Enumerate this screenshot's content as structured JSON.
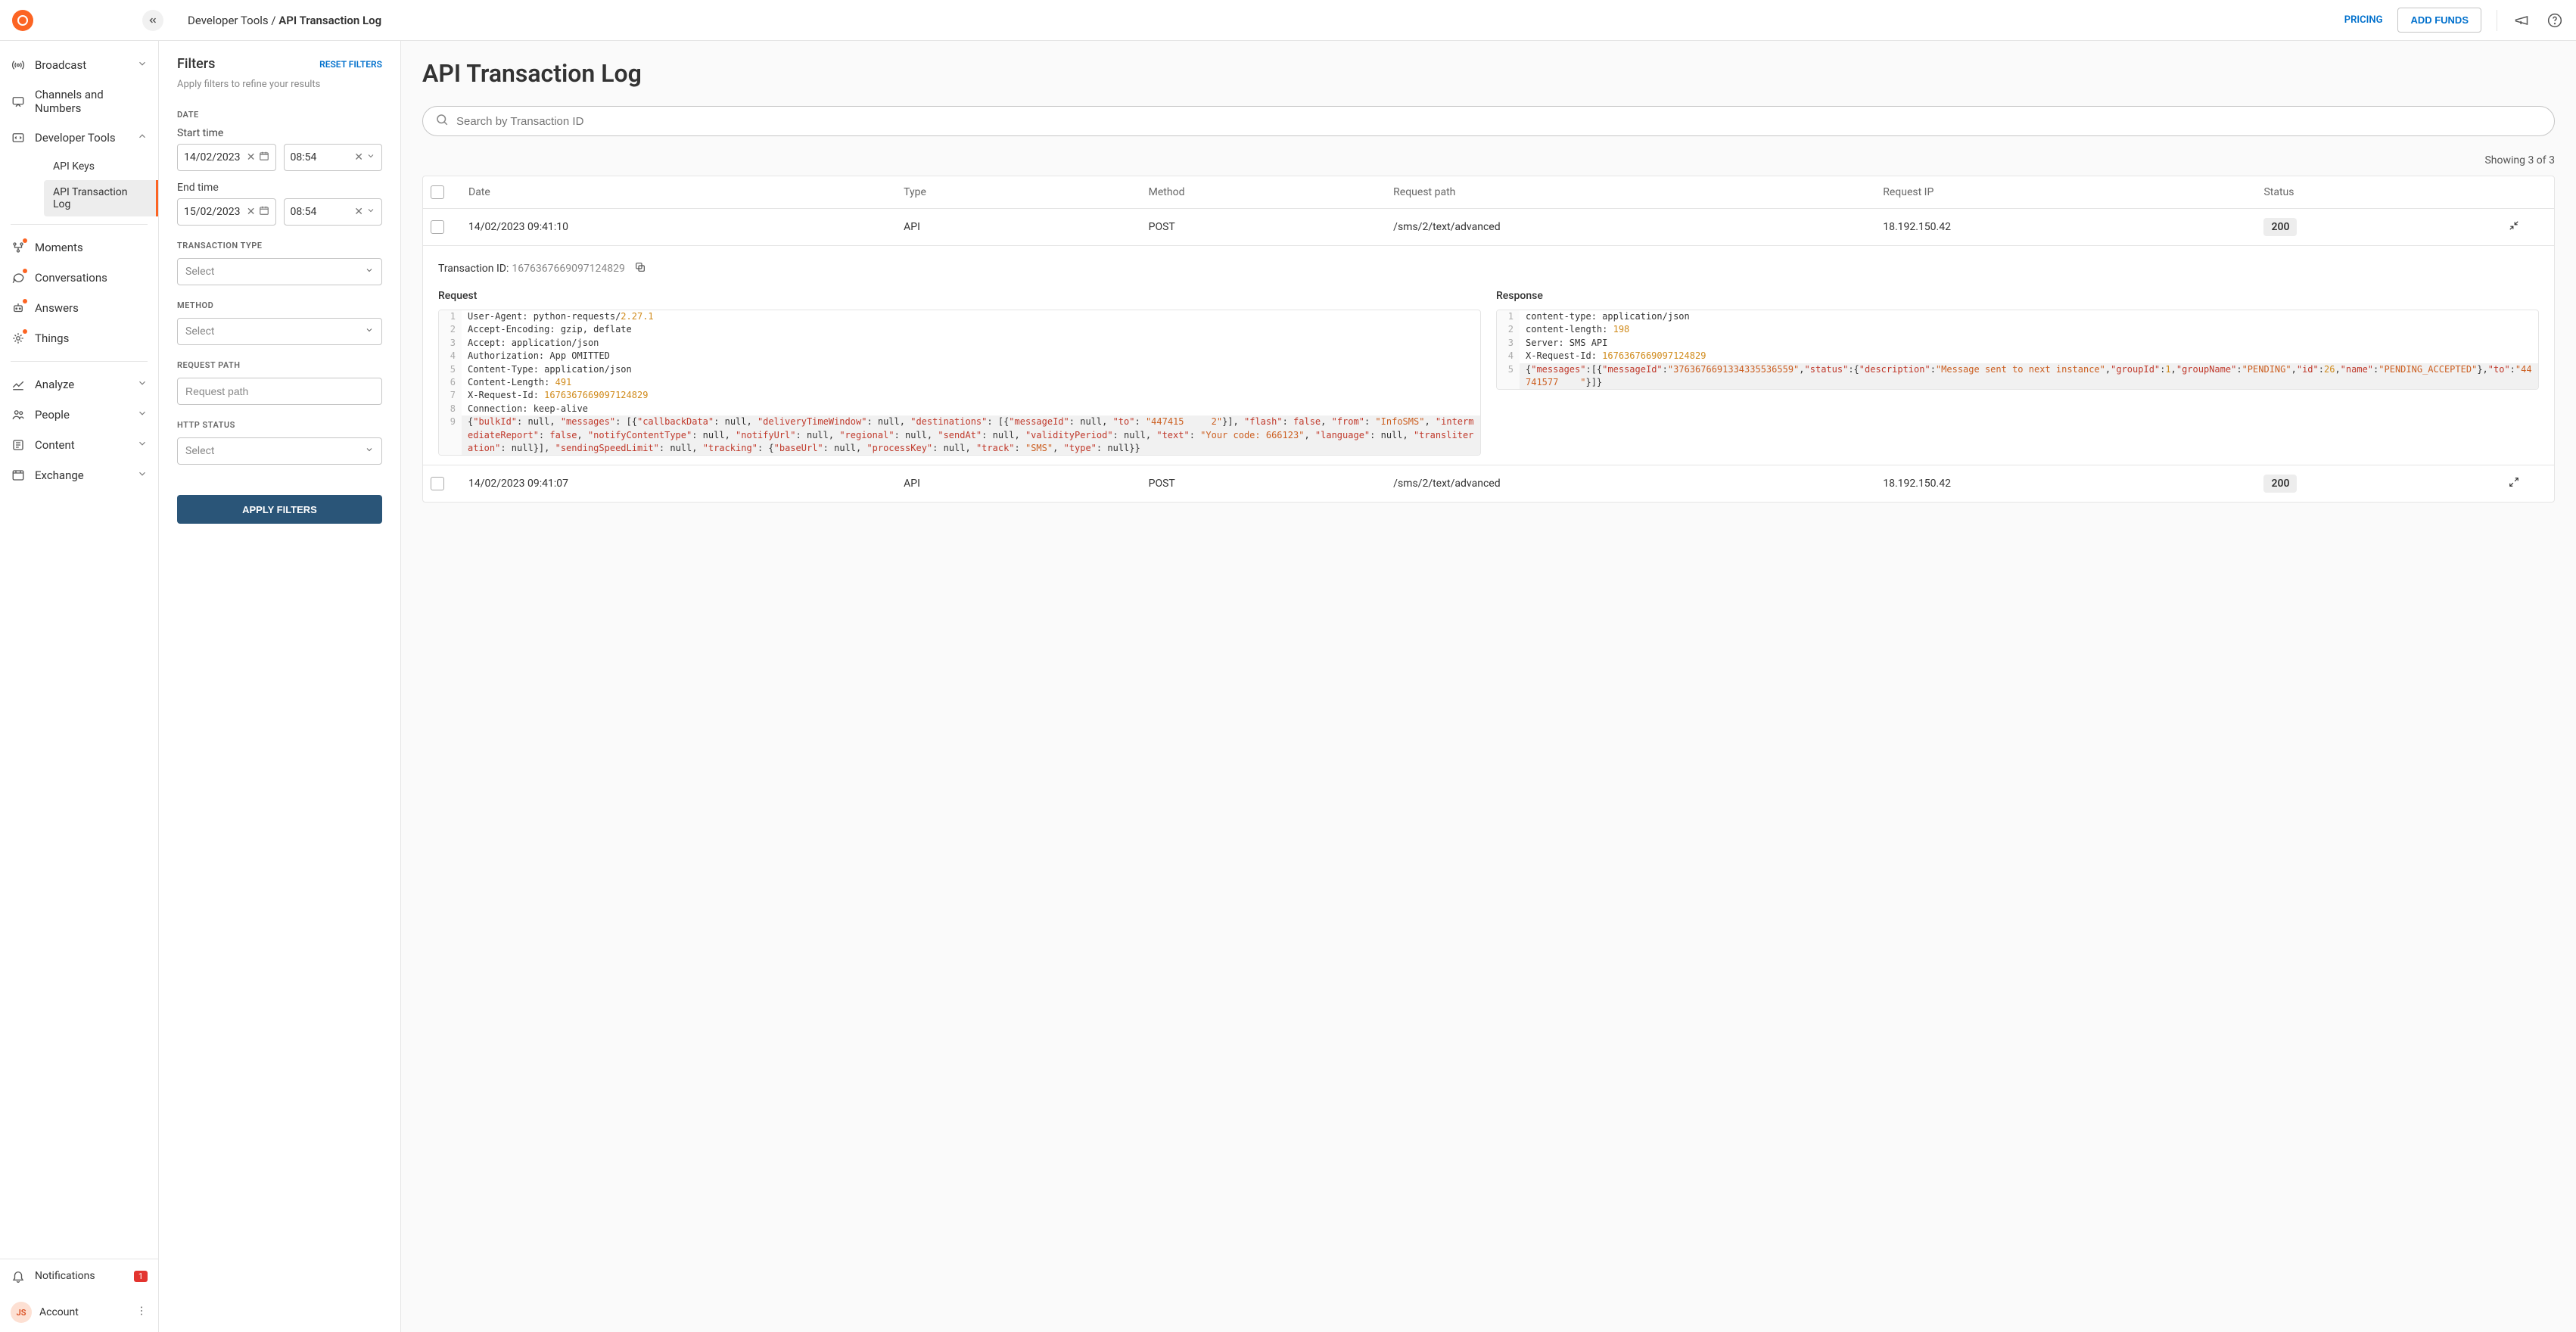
{
  "header": {
    "breadcrumb_parent": "Developer Tools",
    "breadcrumb_sep": " / ",
    "breadcrumb_current": "API Transaction Log",
    "pricing": "PRICING",
    "add_funds": "ADD FUNDS"
  },
  "sidebar": {
    "broadcast": "Broadcast",
    "channels": "Channels and Numbers",
    "dev_tools": "Developer Tools",
    "api_keys": "API Keys",
    "api_log": "API Transaction Log",
    "moments": "Moments",
    "conversations": "Conversations",
    "answers": "Answers",
    "things": "Things",
    "analyze": "Analyze",
    "people": "People",
    "content": "Content",
    "exchange": "Exchange",
    "notifications": "Notifications",
    "notif_count": "1",
    "account": "Account",
    "avatar_initials": "JS"
  },
  "filters": {
    "title": "Filters",
    "reset": "RESET FILTERS",
    "subtitle": "Apply filters to refine your results",
    "date_label": "DATE",
    "start_time": "Start time",
    "start_date": "14/02/2023",
    "start_hour": "08:54",
    "end_time": "End time",
    "end_date": "15/02/2023",
    "end_hour": "08:54",
    "txn_type_label": "TRANSACTION TYPE",
    "method_label": "METHOD",
    "request_path_label": "REQUEST PATH",
    "request_path_placeholder": "Request path",
    "http_status_label": "HTTP STATUS",
    "select_placeholder": "Select",
    "apply": "APPLY FILTERS"
  },
  "main": {
    "title": "API Transaction Log",
    "search_placeholder": "Search by Transaction ID",
    "results_info": "Showing 3 of 3",
    "columns": {
      "date": "Date",
      "type": "Type",
      "method": "Method",
      "request_path": "Request path",
      "request_ip": "Request IP",
      "status": "Status"
    },
    "rows": [
      {
        "date": "14/02/2023 09:41:10",
        "type": "API",
        "method": "POST",
        "path": "/sms/2/text/advanced",
        "ip": "18.192.150.42",
        "status": "200"
      },
      {
        "date": "14/02/2023 09:41:07",
        "type": "API",
        "method": "POST",
        "path": "/sms/2/text/advanced",
        "ip": "18.192.150.42",
        "status": "200"
      }
    ],
    "detail": {
      "txn_id_label": "Transaction ID: ",
      "txn_id": "1676367669097124829",
      "request_title": "Request",
      "response_title": "Response"
    }
  }
}
